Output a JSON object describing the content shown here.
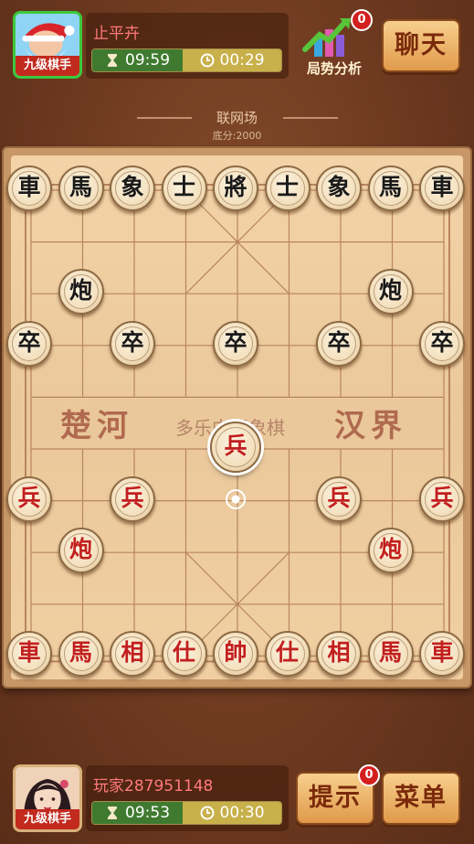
{
  "opponent": {
    "rank": "九级棋手",
    "name": "止平卉",
    "total_time": "09:59",
    "step_time": "00:29"
  },
  "player": {
    "rank": "九级棋手",
    "name": "玩家287951148",
    "total_time": "09:53",
    "step_time": "00:30"
  },
  "top_bar": {
    "analysis_label": "局势分析",
    "analysis_badge": "0",
    "chat_label": "聊天"
  },
  "room": {
    "name": "联网场",
    "base_score": "底分:2000"
  },
  "river": {
    "left": "楚河",
    "center": "多乐中国象棋",
    "right": "汉界"
  },
  "bottom_bar": {
    "hint_label": "提示",
    "hint_badge": "0",
    "menu_label": "菜单"
  },
  "colors": {
    "red_piece": "#c21f1f",
    "black_piece": "#1a1a1a",
    "timer_total_bg": "#3f7a30",
    "timer_step_bg": "#c8b04a"
  },
  "pieces": [
    {
      "label": "車",
      "side": "black",
      "col": 0,
      "row": 0
    },
    {
      "label": "馬",
      "side": "black",
      "col": 1,
      "row": 0
    },
    {
      "label": "象",
      "side": "black",
      "col": 2,
      "row": 0
    },
    {
      "label": "士",
      "side": "black",
      "col": 3,
      "row": 0
    },
    {
      "label": "將",
      "side": "black",
      "col": 4,
      "row": 0
    },
    {
      "label": "士",
      "side": "black",
      "col": 5,
      "row": 0
    },
    {
      "label": "象",
      "side": "black",
      "col": 6,
      "row": 0
    },
    {
      "label": "馬",
      "side": "black",
      "col": 7,
      "row": 0
    },
    {
      "label": "車",
      "side": "black",
      "col": 8,
      "row": 0
    },
    {
      "label": "炮",
      "side": "black",
      "col": 1,
      "row": 2
    },
    {
      "label": "炮",
      "side": "black",
      "col": 7,
      "row": 2
    },
    {
      "label": "卒",
      "side": "black",
      "col": 0,
      "row": 3
    },
    {
      "label": "卒",
      "side": "black",
      "col": 2,
      "row": 3
    },
    {
      "label": "卒",
      "side": "black",
      "col": 4,
      "row": 3
    },
    {
      "label": "卒",
      "side": "black",
      "col": 6,
      "row": 3
    },
    {
      "label": "卒",
      "side": "black",
      "col": 8,
      "row": 3
    },
    {
      "label": "兵",
      "side": "red",
      "col": 4,
      "row": 5,
      "selected": true
    },
    {
      "label": "兵",
      "side": "red",
      "col": 0,
      "row": 6
    },
    {
      "label": "兵",
      "side": "red",
      "col": 2,
      "row": 6
    },
    {
      "label": "兵",
      "side": "red",
      "col": 6,
      "row": 6
    },
    {
      "label": "兵",
      "side": "red",
      "col": 8,
      "row": 6
    },
    {
      "label": "炮",
      "side": "red",
      "col": 1,
      "row": 7
    },
    {
      "label": "炮",
      "side": "red",
      "col": 7,
      "row": 7
    },
    {
      "label": "車",
      "side": "red",
      "col": 0,
      "row": 9
    },
    {
      "label": "馬",
      "side": "red",
      "col": 1,
      "row": 9
    },
    {
      "label": "相",
      "side": "red",
      "col": 2,
      "row": 9
    },
    {
      "label": "仕",
      "side": "red",
      "col": 3,
      "row": 9
    },
    {
      "label": "帥",
      "side": "red",
      "col": 4,
      "row": 9
    },
    {
      "label": "仕",
      "side": "red",
      "col": 5,
      "row": 9
    },
    {
      "label": "相",
      "side": "red",
      "col": 6,
      "row": 9
    },
    {
      "label": "馬",
      "side": "red",
      "col": 7,
      "row": 9
    },
    {
      "label": "車",
      "side": "red",
      "col": 8,
      "row": 9
    }
  ],
  "last_move_from": {
    "col": 4,
    "row": 6
  }
}
